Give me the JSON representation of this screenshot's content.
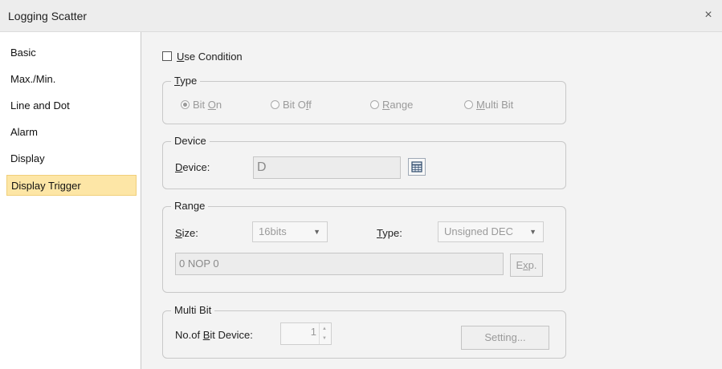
{
  "window": {
    "title": "Logging Scatter",
    "close_glyph": "×"
  },
  "sidebar": {
    "items": [
      {
        "label": "Basic"
      },
      {
        "label": "Max./Min."
      },
      {
        "label": "Line and Dot"
      },
      {
        "label": "Alarm"
      },
      {
        "label": "Display"
      },
      {
        "label": "Display Trigger",
        "selected": true
      }
    ]
  },
  "use_condition": {
    "key": "U",
    "rest": "se Condition",
    "checked": false
  },
  "type_group": {
    "legend_key": "T",
    "legend_rest": "ype",
    "options": [
      {
        "pre": "Bit ",
        "key": "O",
        "post": "n",
        "checked": true
      },
      {
        "pre": "Bit O",
        "key": "f",
        "post": "f",
        "checked": false
      },
      {
        "pre": "",
        "key": "R",
        "post": "ange",
        "checked": false
      },
      {
        "pre": "",
        "key": "M",
        "post": "ulti Bit",
        "checked": false
      }
    ]
  },
  "device_group": {
    "legend": "Device",
    "label_key": "D",
    "label_rest": "evice:",
    "value": "D",
    "icon": "device-browser-icon"
  },
  "range_group": {
    "legend": "Range",
    "size_key": "S",
    "size_rest": "ize:",
    "size_value": "16bits",
    "type_key": "T",
    "type_rest": "ype:",
    "type_value": "Unsigned DEC",
    "expression": "0 NOP 0",
    "exp_pre": "E",
    "exp_key": "x",
    "exp_post": "p."
  },
  "multibit_group": {
    "legend": "Multi Bit",
    "label_pre": "No.of ",
    "label_key": "B",
    "label_post": "it Device:",
    "value": "1",
    "setting_label": "Setting..."
  },
  "colors": {
    "selected_bg": "#fde6a6",
    "selected_border": "#f0cf7a",
    "panel_bg": "#f3f3f3"
  }
}
